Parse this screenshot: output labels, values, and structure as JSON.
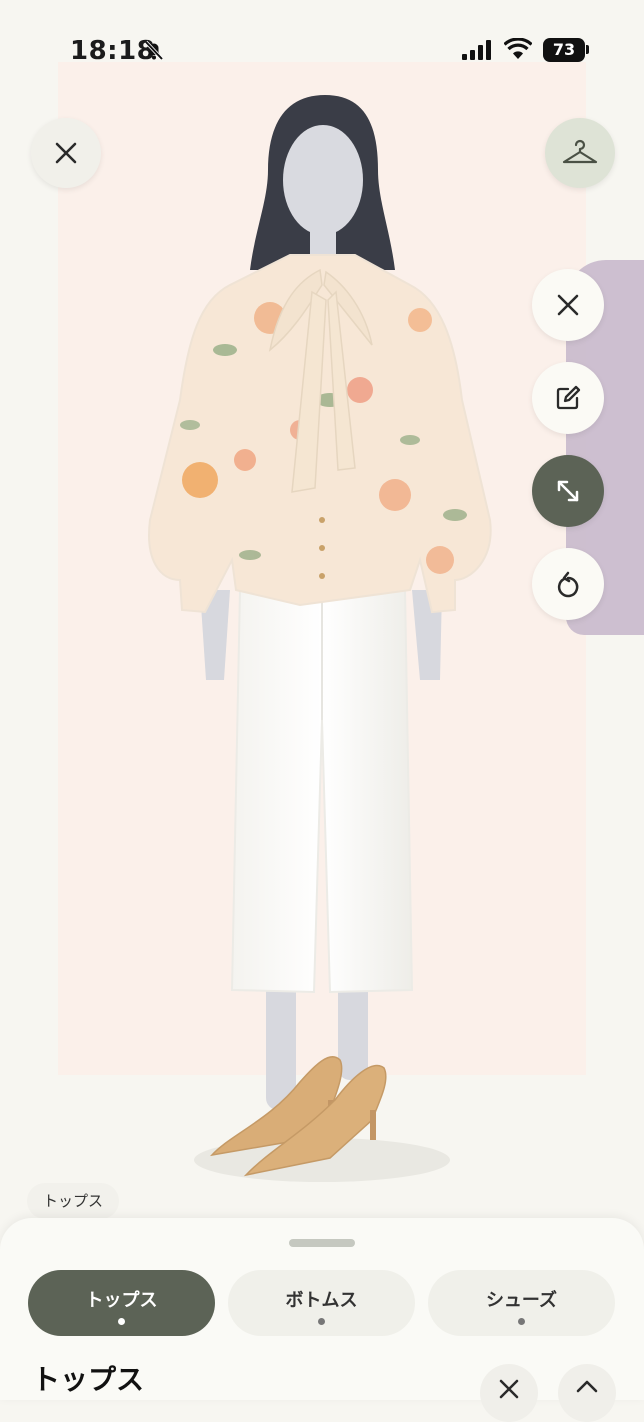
{
  "status_bar": {
    "time": "18:18",
    "battery": "73"
  },
  "stage": {
    "category_badge": "トップス"
  },
  "icons": {
    "close": "close-icon",
    "hanger": "hanger-icon",
    "edit": "edit-icon",
    "expand": "expand-icon",
    "reset": "reset-icon",
    "chevron_up": "chevron-up-icon"
  },
  "sheet": {
    "tabs": [
      {
        "label": "トップス",
        "active": true
      },
      {
        "label": "ボトムス",
        "active": false
      },
      {
        "label": "シューズ",
        "active": false
      }
    ],
    "title": "トップス"
  }
}
